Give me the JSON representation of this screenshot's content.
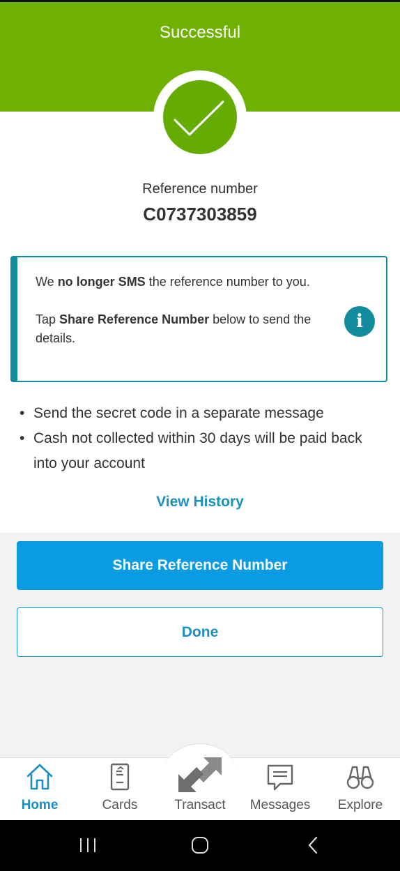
{
  "header": {
    "title": "Successful"
  },
  "reference": {
    "label": "Reference number",
    "number": "C0737303859"
  },
  "info": {
    "line1_prefix": "We ",
    "line1_bold": "no longer SMS",
    "line1_suffix": " the reference number to you.",
    "line2_prefix": "Tap ",
    "line2_bold": "Share Reference Number",
    "line2_suffix": " below to send the details.",
    "icon": "info-icon"
  },
  "bullets": [
    "Send the secret code in a separate message",
    "Cash not collected within 30 days will be paid back into your account"
  ],
  "links": {
    "view_history": "View History"
  },
  "buttons": {
    "share": "Share Reference Number",
    "done": "Done"
  },
  "nav": {
    "items": [
      {
        "label": "Home",
        "icon": "home-icon",
        "active": true
      },
      {
        "label": "Cards",
        "icon": "card-icon",
        "active": false
      },
      {
        "label": "Transact",
        "icon": "transact-icon",
        "active": false
      },
      {
        "label": "Messages",
        "icon": "message-icon",
        "active": false
      },
      {
        "label": "Explore",
        "icon": "binoculars-icon",
        "active": false
      }
    ]
  },
  "colors": {
    "header_green": "#6eb100",
    "check_green": "#64ad00",
    "teal": "#128c9c",
    "primary_blue": "#0a9be3",
    "link_blue": "#1a8fc2"
  }
}
